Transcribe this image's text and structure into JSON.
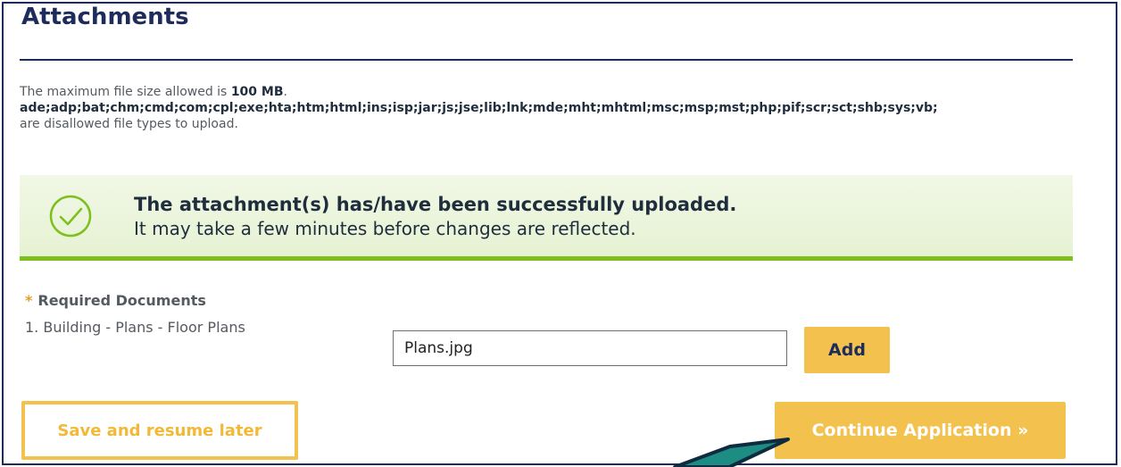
{
  "section": {
    "title": "Attachments"
  },
  "info": {
    "size_prefix": "The maximum file size allowed is ",
    "size_value": "100 MB",
    "size_suffix": ".",
    "disallowed_types": "ade;adp;bat;chm;cmd;com;cpl;exe;hta;htm;html;ins;isp;jar;js;jse;lib;lnk;mde;mht;mhtml;msc;msp;mst;php;pif;scr;sct;shb;sys;vb;",
    "disallowed_suffix": "are disallowed file types to upload."
  },
  "alert": {
    "icon": "check-circle-icon",
    "title": "The attachment(s) has/have been successfully uploaded.",
    "subtitle": "It may take a few minutes before changes are reflected.",
    "colors": {
      "background": "#e9f4d9",
      "border": "#7dc01d",
      "icon": "#7dc01d"
    }
  },
  "required": {
    "marker": "*",
    "title": "Required Documents",
    "items": [
      {
        "label": "1. Building - Plans - Floor Plans"
      }
    ]
  },
  "upload": {
    "file_value": "Plans.jpg",
    "add_label": "Add"
  },
  "actions": {
    "save_label": "Save and resume later",
    "continue_label": "Continue Application »"
  },
  "colors": {
    "accent": "#f2c14e",
    "heading": "#1d2c5b",
    "pointer": "#1d8c83"
  }
}
